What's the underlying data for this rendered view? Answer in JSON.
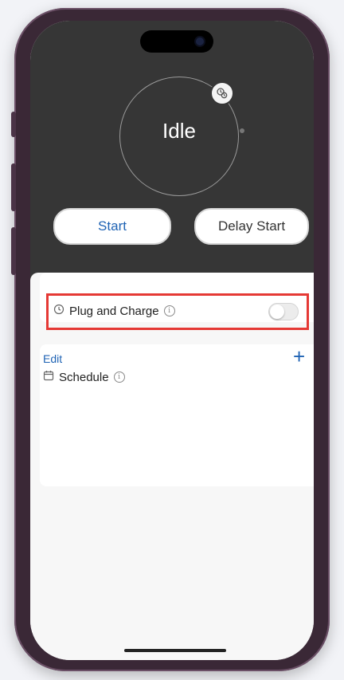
{
  "charger": {
    "status": "Idle",
    "status_progress": 0
  },
  "actions": {
    "start_label": "Start",
    "delay_start_label": "Delay Start"
  },
  "plug_and_charge": {
    "label": "Plug and Charge",
    "info_glyph": "i",
    "enabled": false
  },
  "schedule": {
    "edit_label": "Edit",
    "add_glyph": "+",
    "label": "Schedule",
    "info_glyph": "i"
  },
  "colors": {
    "accent": "#1f63b4",
    "header_bg": "#363636",
    "highlight": "#e53935"
  },
  "icons": {
    "schedule_badge": "schedule-badge-icon",
    "plug": "plug-clock-icon",
    "calendar": "calendar-icon",
    "info": "info-icon"
  }
}
